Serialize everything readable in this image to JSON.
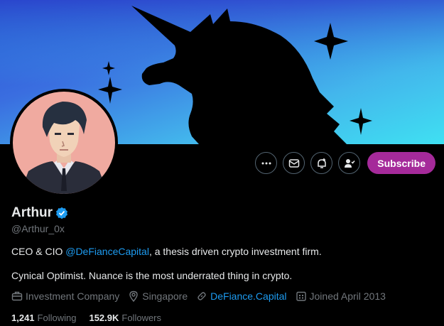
{
  "header": {
    "banner_icon": "unicorn-silhouette-banner",
    "avatar_icon": "anime-portrait-avatar"
  },
  "actions": {
    "more_icon": "more-icon",
    "message_icon": "message-icon",
    "notify_icon": "notification-bell-plus-icon",
    "following_icon": "person-check-icon",
    "subscribe_label": "Subscribe",
    "subscribe_color": "#a52a9a"
  },
  "profile": {
    "name": "Arthur",
    "verified_icon": "verified-badge-icon",
    "verified_color": "#1d9bf0",
    "handle": "@Arthur_0x",
    "bio_prefix": "CEO & CIO ",
    "bio_mention": "@DeFianceCapital",
    "bio_suffix": ", a thesis driven crypto investment firm.",
    "bio_line2": "Cynical Optimist. Nuance is the most underrated thing in crypto."
  },
  "meta": {
    "category": "Investment Company",
    "location": "Singapore",
    "website": "DeFiance.Capital",
    "joined": "Joined April 2013"
  },
  "stats": {
    "following_count": "1,241",
    "following_label": "Following",
    "followers_count": "152.9K",
    "followers_label": "Followers"
  },
  "colors": {
    "link": "#1d9bf0",
    "muted": "#71767b",
    "text": "#e7e9ea"
  }
}
